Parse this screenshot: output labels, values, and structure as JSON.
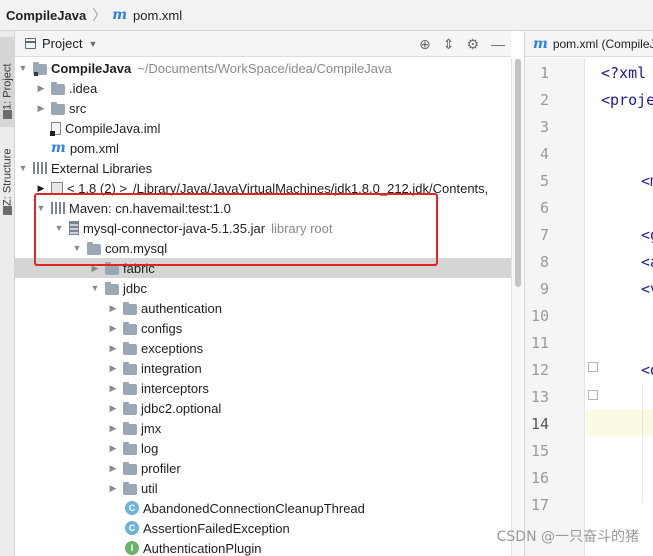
{
  "breadcrumb": {
    "project": "CompileJava",
    "file": "pom.xml"
  },
  "toolstrip": {
    "project_tab": "1: Project",
    "structure_tab": "Z: Structure"
  },
  "panel": {
    "title": "Project"
  },
  "tree": [
    {
      "label": "CompileJava",
      "suffix": "~/Documents/WorkSpace/idea/CompileJava",
      "icon": "project-folder-icon"
    },
    {
      "label": ".idea",
      "icon": "folder-icon"
    },
    {
      "label": "src",
      "icon": "folder-icon"
    },
    {
      "label": "CompileJava.iml",
      "icon": "iml-file-icon"
    },
    {
      "label": "pom.xml",
      "icon": "maven-icon"
    },
    {
      "label": "External Libraries",
      "icon": "libraries-icon"
    },
    {
      "label": "< 1.8 (2) >",
      "suffix": "/Library/Java/JavaVirtualMachines/jdk1.8.0_212.jdk/Contents,",
      "icon": "jdk-icon"
    },
    {
      "label": "Maven: cn.havemail:test:1.0",
      "icon": "library-icon"
    },
    {
      "label": "mysql-connector-java-5.1.35.jar",
      "hint": "library root",
      "icon": "jar-icon"
    },
    {
      "label": "com.mysql",
      "icon": "package-icon"
    },
    {
      "label": "fabric",
      "icon": "package-icon"
    },
    {
      "label": "jdbc",
      "icon": "package-icon"
    },
    {
      "label": "authentication",
      "icon": "package-icon"
    },
    {
      "label": "configs",
      "icon": "package-icon"
    },
    {
      "label": "exceptions",
      "icon": "package-icon"
    },
    {
      "label": "integration",
      "icon": "package-icon"
    },
    {
      "label": "interceptors",
      "icon": "package-icon"
    },
    {
      "label": "jdbc2.optional",
      "icon": "package-icon"
    },
    {
      "label": "jmx",
      "icon": "package-icon"
    },
    {
      "label": "log",
      "icon": "package-icon"
    },
    {
      "label": "profiler",
      "icon": "package-icon"
    },
    {
      "label": "util",
      "icon": "package-icon"
    },
    {
      "label": "AbandonedConnectionCleanupThread",
      "icon": "class-icon",
      "badge": "C"
    },
    {
      "label": "AssertionFailedException",
      "icon": "class-icon",
      "badge": "C"
    },
    {
      "label": "AuthenticationPlugin",
      "icon": "interface-icon",
      "badge": "I"
    }
  ],
  "editor": {
    "tab": "pom.xml (CompileJ",
    "line_numbers": [
      "1",
      "2",
      "3",
      "4",
      "5",
      "6",
      "7",
      "8",
      "9",
      "10",
      "11",
      "12",
      "13",
      "14",
      "15",
      "16",
      "17"
    ],
    "code_lines": {
      "l1": "<?xml",
      "l2": "<proje",
      "l5": "<m",
      "l7": "<g",
      "l8": "<a",
      "l9": "<v",
      "l12": "<d"
    },
    "current_line": "14"
  },
  "watermark": "CSDN @一只奋斗的猪",
  "colors": {
    "highlight_box": "#e02525",
    "selected_row": "#d5d5d5",
    "xml_tag": "#1b1b9e"
  }
}
